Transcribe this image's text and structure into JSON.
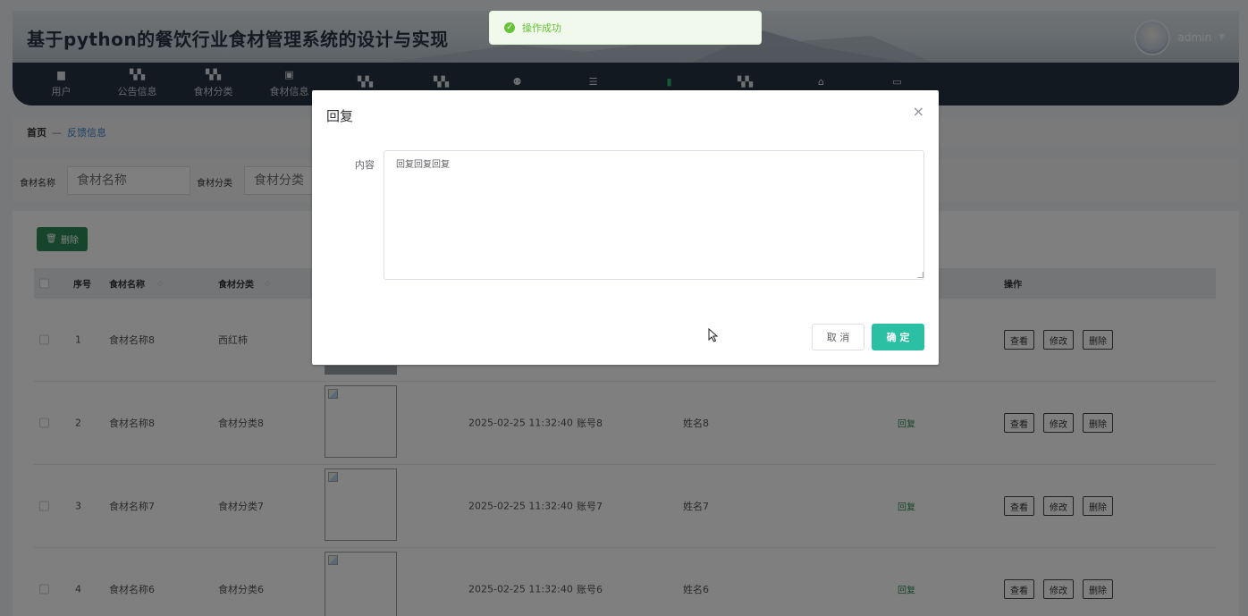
{
  "header": {
    "title": "基于python的餐饮行业食材管理系统的设计与实现",
    "username": "admin"
  },
  "nav": {
    "items": [
      {
        "label": "用户",
        "icon": "briefcase-icon"
      },
      {
        "label": "公告信息",
        "icon": "grid-icon"
      },
      {
        "label": "食材分类",
        "icon": "grid-icon"
      },
      {
        "label": "食材信息",
        "icon": "image-icon"
      },
      {
        "label": "",
        "icon": "grid-icon"
      },
      {
        "label": "",
        "icon": "grid-icon"
      },
      {
        "label": "",
        "icon": "user-icon"
      },
      {
        "label": "",
        "icon": "sliders-icon"
      },
      {
        "label": "",
        "icon": "database-icon"
      },
      {
        "label": "",
        "icon": "grid-icon"
      },
      {
        "label": "",
        "icon": "home-icon"
      },
      {
        "label": "",
        "icon": "card-icon"
      }
    ]
  },
  "breadcrumb": {
    "home": "首页",
    "separator": "—",
    "current": "反馈信息"
  },
  "search": {
    "name_label": "食材名称",
    "name_placeholder": "食材名称",
    "category_label": "食材分类",
    "category_placeholder": "食材分类"
  },
  "toolbar": {
    "delete_label": "删除"
  },
  "table": {
    "headers": {
      "index": "序号",
      "name": "食材名称",
      "category": "食材分类",
      "actions": "操作"
    },
    "rows": [
      {
        "index": "1",
        "name": "食材名称8",
        "category": "西红柿",
        "time": "",
        "account": "",
        "realname": "",
        "reply": ""
      },
      {
        "index": "2",
        "name": "食材名称8",
        "category": "食材分类8",
        "time": "2025-02-25 11:32:40",
        "account": "账号8",
        "realname": "姓名8",
        "reply": "回复"
      },
      {
        "index": "3",
        "name": "食材名称7",
        "category": "食材分类7",
        "time": "2025-02-25 11:32:40",
        "account": "账号7",
        "realname": "姓名7",
        "reply": "回复"
      },
      {
        "index": "4",
        "name": "食材名称6",
        "category": "食材分类6",
        "time": "2025-02-25 11:32:40",
        "account": "账号6",
        "realname": "姓名6",
        "reply": "回复"
      }
    ],
    "row_actions": {
      "view": "查看",
      "edit": "修改",
      "delete": "删除"
    }
  },
  "toast": {
    "message": "操作成功"
  },
  "dialog": {
    "title": "回复",
    "content_label": "内容",
    "content_value": "回复回复回复",
    "cancel_label": "取 消",
    "confirm_label": "确 定"
  },
  "colors": {
    "primary_green": "#2e8b57",
    "confirm_teal": "#2bbfa4",
    "nav_bg": "#263240",
    "toast_green": "#67c23a"
  }
}
